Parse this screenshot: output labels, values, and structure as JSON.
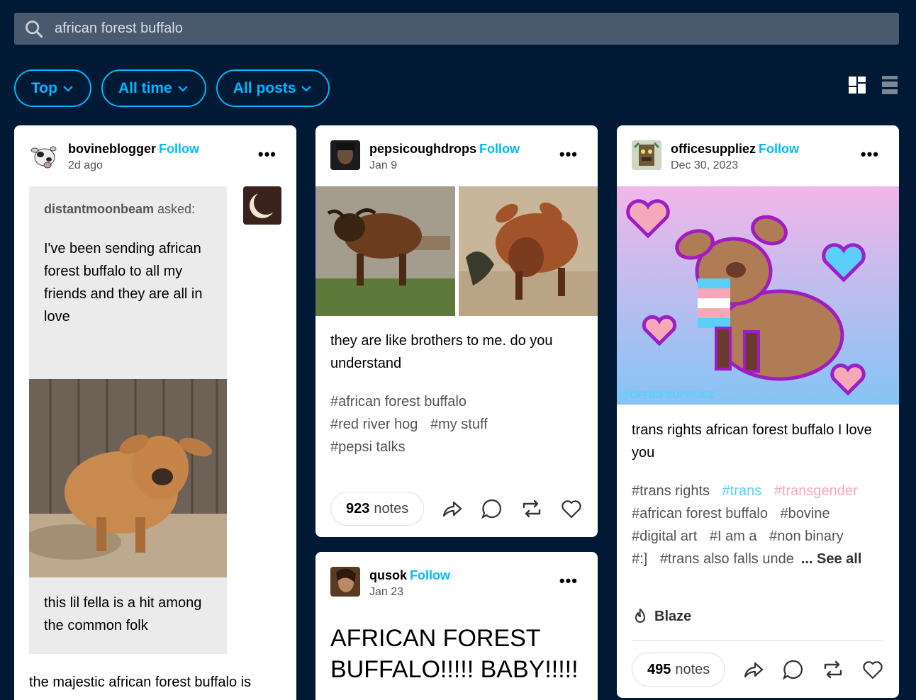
{
  "search": {
    "value": "african forest buffalo"
  },
  "filters": [
    {
      "label": "Top"
    },
    {
      "label": "All time"
    },
    {
      "label": "All posts"
    }
  ],
  "posts": [
    {
      "blog": "bovineblogger",
      "follow": "Follow",
      "date": "2d ago",
      "asker": "distantmoonbeam",
      "asked_suffix": "asked:",
      "question": "I've been sending african forest buffalo to all my friends and they are all in love",
      "caption": "this lil fella is a hit among the common folk",
      "body": "the majestic african forest buffalo is"
    },
    {
      "blog": "pepsicoughdrops",
      "follow": "Follow",
      "date": "Jan 9",
      "body": "they are like brothers to me. do you understand",
      "tags": [
        "#african forest buffalo",
        "#red river hog",
        "#my stuff",
        "#pepsi talks"
      ],
      "notes_count": "923",
      "notes_label": "notes"
    },
    {
      "blog": "qusok",
      "follow": "Follow",
      "date": "Jan 23",
      "body": "AFRICAN FOREST BUFFALO!!!!! BABY!!!!!"
    },
    {
      "blog": "officesuppliez",
      "follow": "Follow",
      "date": "Dec 30, 2023",
      "watermark": "@OFFICESUPPLIEZ",
      "body": "trans rights african forest buffalo I love you",
      "tags": [
        "#trans rights",
        "#trans",
        "#transgender",
        "#african forest buffalo",
        "#bovine",
        "#digital art",
        "#I am a",
        "#non binary",
        "#:]",
        "#trans also falls unde"
      ],
      "see_all": "... See all",
      "blaze": "Blaze",
      "notes_count": "495",
      "notes_label": "notes"
    }
  ],
  "colors": {
    "accent": "#00b8ff",
    "background": "#001935",
    "trans_blue": "#5bcefa",
    "trans_pink": "#f5a9b8"
  }
}
